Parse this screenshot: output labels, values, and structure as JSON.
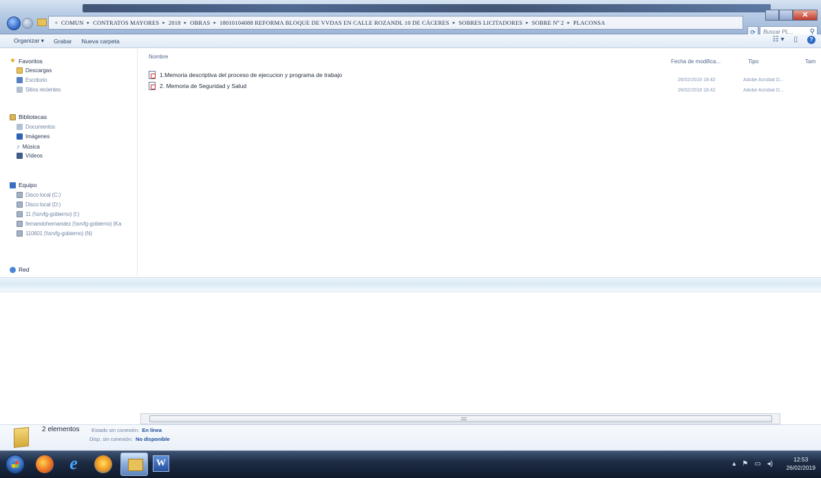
{
  "address": {
    "crumbs": [
      "COMUN",
      "CONTRATOS MAYORES",
      "2018",
      "OBRAS",
      "18010104088 REFORMA BLOQUE DE VVDAS EN CALLE ROZANDL 10 DE CÁCERES",
      "SOBRES LICITADORES",
      "SOBRE Nº 2",
      "PLACONSA"
    ],
    "search_placeholder": "Buscar PL..."
  },
  "toolbar": {
    "organize": "Organizar ▾",
    "burn": "Grabar",
    "new_folder": "Nueva carpeta",
    "views": "☷ ▾"
  },
  "nav": {
    "favorites": "Favoritos",
    "downloads": "Descargas",
    "desktop": "Escritorio",
    "recent": "Sitios recientes",
    "libraries": "Bibliotecas",
    "documents": "Documentos",
    "images": "Imágenes",
    "music": "Música",
    "videos": "Vídeos",
    "computer": "Equipo",
    "drive_c": "Disco local (C:)",
    "drive_d": "Disco local (D:)",
    "net1": "11 (\\\\srvfg-gobierno) (I:)",
    "net2": "fernandohernandez (\\\\srvfg-gobierno) (Ka",
    "net3": "110601 (\\\\srvfg-gobierno) (N)",
    "network": "Red"
  },
  "columns": {
    "name": "Nombre",
    "modified": "Fecha de modifica...",
    "type": "Tipo",
    "size": "Tam"
  },
  "files": [
    {
      "name": "1.Memoria descriptiva del proceso de ejecucion y programa de trabajo",
      "date": "26/02/2019 18:42",
      "type": "Adobe Acrobat D..."
    },
    {
      "name": "2. Memoria de Seguridad y Salud",
      "date": "26/02/2019 18:42",
      "type": "Adobe Acrobat D..."
    }
  ],
  "details": {
    "count": "2 elementos",
    "offline_status_label": "Estado sin conexión:",
    "offline_status_value": "En línea",
    "offline_avail_label": "Disp. sin conexión:",
    "offline_avail_value": "No disponible"
  },
  "taskbar": {
    "time": "12:53",
    "date": "26/02/2019",
    "word_glyph": "W",
    "ie_glyph": "e"
  }
}
